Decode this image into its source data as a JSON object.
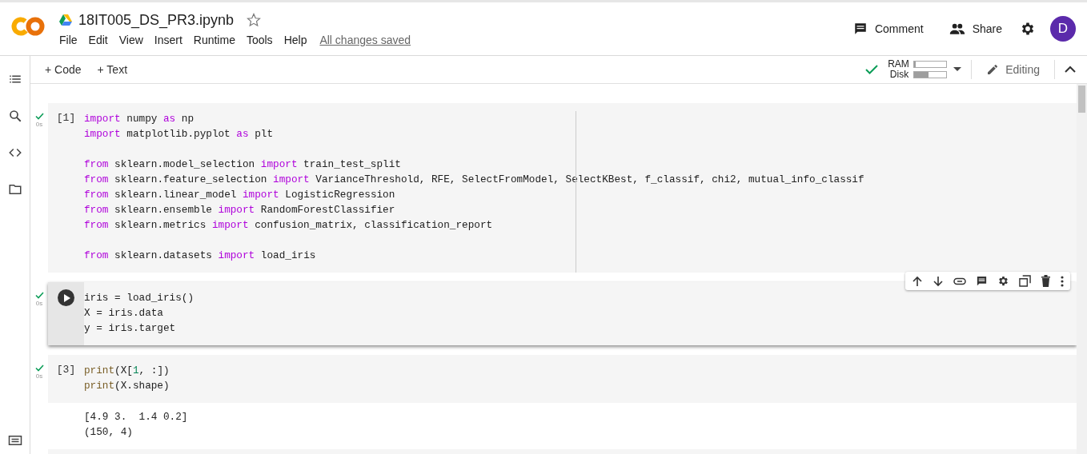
{
  "header": {
    "title": "18IT005_DS_PR3.ipynb",
    "starred": false,
    "menu": [
      "File",
      "Edit",
      "View",
      "Insert",
      "Runtime",
      "Tools",
      "Help"
    ],
    "save_status": "All changes saved",
    "comment_label": "Comment",
    "share_label": "Share",
    "avatar_letter": "D"
  },
  "toolbar": {
    "add_code": "+ Code",
    "add_text": "+ Text",
    "connected": true,
    "ram_label": "RAM",
    "ram": {
      "level": 0.05
    },
    "disk_label": "Disk",
    "disk": {
      "level": 0.45
    },
    "mode": "Editing"
  },
  "cells": [
    {
      "prompt": "[1]",
      "done": true,
      "time": "0s",
      "selected": false,
      "lines": [
        {
          "kind": "code",
          "tokens": [
            {
              "kind": "keyword",
              "text": "import"
            },
            {
              "kind": "plain",
              "text": " numpy "
            },
            {
              "kind": "keyword",
              "text": "as"
            },
            {
              "kind": "plain",
              "text": " np"
            }
          ]
        },
        {
          "kind": "code",
          "tokens": [
            {
              "kind": "keyword",
              "text": "import"
            },
            {
              "kind": "plain",
              "text": " matplotlib.pyplot "
            },
            {
              "kind": "keyword",
              "text": "as"
            },
            {
              "kind": "plain",
              "text": " plt"
            }
          ]
        },
        {
          "kind": "blank"
        },
        {
          "kind": "code",
          "tokens": [
            {
              "kind": "keyword",
              "text": "from"
            },
            {
              "kind": "plain",
              "text": " sklearn.model_selection "
            },
            {
              "kind": "keyword",
              "text": "import"
            },
            {
              "kind": "plain",
              "text": " train_test_split"
            }
          ]
        },
        {
          "kind": "code",
          "tokens": [
            {
              "kind": "keyword",
              "text": "from"
            },
            {
              "kind": "plain",
              "text": " sklearn.feature_selection "
            },
            {
              "kind": "keyword",
              "text": "import"
            },
            {
              "kind": "plain",
              "text": " VarianceThreshold, RFE, SelectFromModel, SelectKBest, f_classif, chi2, mutual_info_classif"
            }
          ]
        },
        {
          "kind": "code",
          "tokens": [
            {
              "kind": "keyword",
              "text": "from"
            },
            {
              "kind": "plain",
              "text": " sklearn.linear_model "
            },
            {
              "kind": "keyword",
              "text": "import"
            },
            {
              "kind": "plain",
              "text": " LogisticRegression"
            }
          ]
        },
        {
          "kind": "code",
          "tokens": [
            {
              "kind": "keyword",
              "text": "from"
            },
            {
              "kind": "plain",
              "text": " sklearn.ensemble "
            },
            {
              "kind": "keyword",
              "text": "import"
            },
            {
              "kind": "plain",
              "text": " RandomForestClassifier"
            }
          ]
        },
        {
          "kind": "code",
          "tokens": [
            {
              "kind": "keyword",
              "text": "from"
            },
            {
              "kind": "plain",
              "text": " sklearn.metrics "
            },
            {
              "kind": "keyword",
              "text": "import"
            },
            {
              "kind": "plain",
              "text": " confusion_matrix, classification_report"
            }
          ]
        },
        {
          "kind": "blank"
        },
        {
          "kind": "code",
          "tokens": [
            {
              "kind": "keyword",
              "text": "from"
            },
            {
              "kind": "plain",
              "text": " sklearn.datasets "
            },
            {
              "kind": "keyword",
              "text": "import"
            },
            {
              "kind": "plain",
              "text": " load_iris"
            }
          ]
        }
      ]
    },
    {
      "done": true,
      "time": "0s",
      "selected": true,
      "lines": [
        {
          "kind": "code",
          "tokens": [
            {
              "kind": "plain",
              "text": "iris = load_iris()"
            }
          ]
        },
        {
          "kind": "code",
          "tokens": [
            {
              "kind": "plain",
              "text": "X = iris.data"
            }
          ]
        },
        {
          "kind": "code",
          "tokens": [
            {
              "kind": "plain",
              "text": "y = iris.target"
            }
          ]
        }
      ]
    },
    {
      "prompt": "[3]",
      "done": true,
      "time": "0s",
      "selected": false,
      "lines": [
        {
          "kind": "code",
          "tokens": [
            {
              "kind": "builtin",
              "text": "print"
            },
            {
              "kind": "plain",
              "text": "(X["
            },
            {
              "kind": "number",
              "text": "1"
            },
            {
              "kind": "plain",
              "text": ", :])"
            }
          ]
        },
        {
          "kind": "code",
          "tokens": [
            {
              "kind": "builtin",
              "text": "print"
            },
            {
              "kind": "plain",
              "text": "(X.shape)"
            }
          ]
        }
      ],
      "output": [
        "[4.9 3.  1.4 0.2]",
        "(150, 4)"
      ]
    }
  ]
}
